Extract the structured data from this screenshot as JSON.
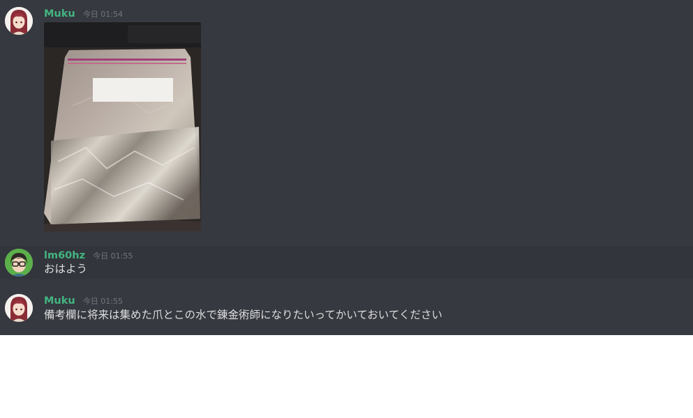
{
  "messages": [
    {
      "username": "Muku",
      "timestamp": "今日 01:54",
      "avatar": "anime-girl-avatar",
      "attachment": "photo-zip-bag-image"
    },
    {
      "username": "lm60hz",
      "timestamp": "今日 01:55",
      "avatar": "glasses-character-avatar",
      "text": "おはよう"
    },
    {
      "username": "Muku",
      "timestamp": "今日 01:55",
      "avatar": "anime-girl-avatar",
      "text": "備考欄に将来は集めた爪とこの水で錬金術師になりたいってかいておいてください"
    }
  ],
  "colors": {
    "background": "#36393f",
    "username": "#43b581",
    "timestamp": "#72767d",
    "text": "#dcddde"
  }
}
